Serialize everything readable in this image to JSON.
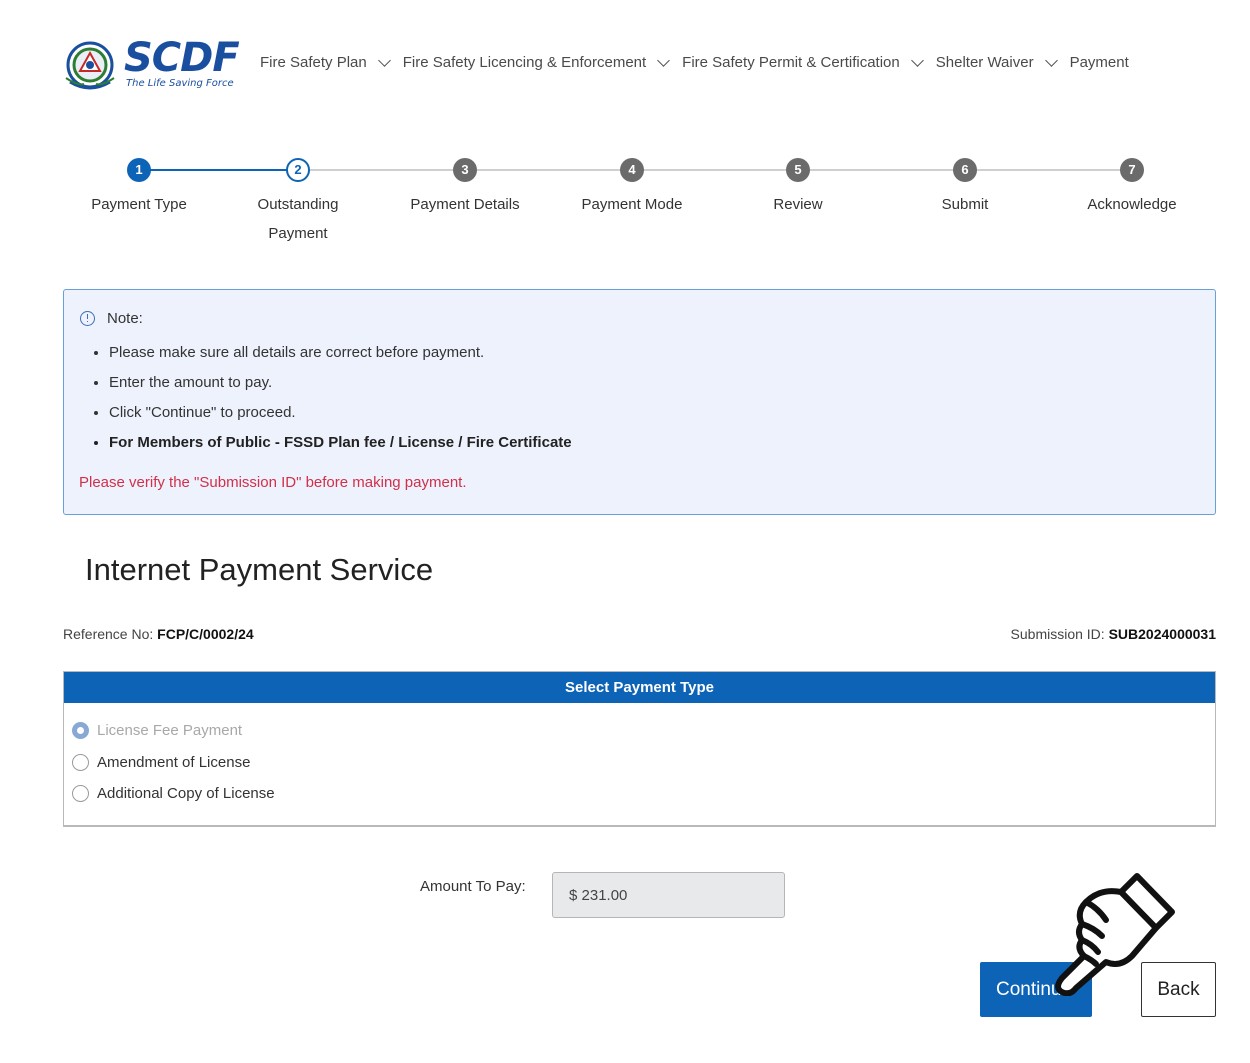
{
  "header": {
    "logo_text": "SCDF",
    "logo_tagline": "The Life Saving Force",
    "nav": [
      {
        "label": "Fire Safety Plan",
        "has_dropdown": true
      },
      {
        "label": "Fire Safety Licencing & Enforcement",
        "has_dropdown": true
      },
      {
        "label": "Fire Safety Permit & Certification",
        "has_dropdown": true
      },
      {
        "label": "Shelter Waiver",
        "has_dropdown": true
      },
      {
        "label": "Payment",
        "has_dropdown": false
      }
    ]
  },
  "stepper": {
    "steps": [
      {
        "num": "1",
        "label": "Payment Type",
        "state": "done"
      },
      {
        "num": "2",
        "label": "Outstanding Payment",
        "state": "current"
      },
      {
        "num": "3",
        "label": "Payment Details",
        "state": "pending"
      },
      {
        "num": "4",
        "label": "Payment Mode",
        "state": "pending"
      },
      {
        "num": "5",
        "label": "Review",
        "state": "pending"
      },
      {
        "num": "6",
        "label": "Submit",
        "state": "pending"
      },
      {
        "num": "7",
        "label": "Acknowledge",
        "state": "pending"
      }
    ]
  },
  "note": {
    "title": "Note:",
    "items": [
      "Please make sure all details are correct before payment.",
      "Enter the amount to pay.",
      "Click \"Continue\" to proceed.",
      "For Members of Public - FSSD Plan fee / License / Fire Certificate"
    ],
    "warning": "Please verify the \"Submission ID\" before making payment."
  },
  "page_title": "Internet Payment Service",
  "reference": {
    "label": "Reference No:",
    "value": "FCP/C/0002/24"
  },
  "submission": {
    "label": "Submission ID:",
    "value": "SUB2024000031"
  },
  "payment_type": {
    "header": "Select Payment Type",
    "options": [
      {
        "label": "License Fee Payment",
        "checked": true,
        "disabled": true
      },
      {
        "label": "Amendment of License",
        "checked": false,
        "disabled": false
      },
      {
        "label": "Additional Copy of License",
        "checked": false,
        "disabled": false
      }
    ]
  },
  "amount": {
    "label": "Amount To Pay:",
    "value": "$ 231.00"
  },
  "buttons": {
    "continue": "Continue",
    "back": "Back"
  },
  "colors": {
    "primary": "#0d63b5",
    "note_bg": "#eef2fd",
    "warning": "#d0304a",
    "logo": "#1a4fa0"
  },
  "icons": {
    "note": "info-icon",
    "cursor": "pointing-hand-icon",
    "nav_dropdown": "chevron-down-icon"
  }
}
